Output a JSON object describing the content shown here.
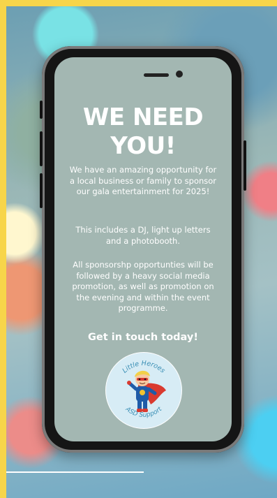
{
  "headline": [
    "WE NEED",
    "YOU!"
  ],
  "paragraphs": [
    "We have an amazing opportunity for a local business or family to sponsor our gala entertainment for 2025!",
    "This includes a DJ, light up letters and a photobooth.",
    "All sponsorshp opportunties will be followed by a heavy social media promotion, as well as promotion on the evening and within the event programme."
  ],
  "cta": "Get in touch today!",
  "logo": {
    "top_text": "Little Heroes",
    "bottom_text": "ASD Support",
    "icon": "superhero-boy-icon"
  },
  "colors": {
    "frame": "#f7d54a",
    "screen": "#a3b7b2",
    "text": "#ffffff"
  }
}
